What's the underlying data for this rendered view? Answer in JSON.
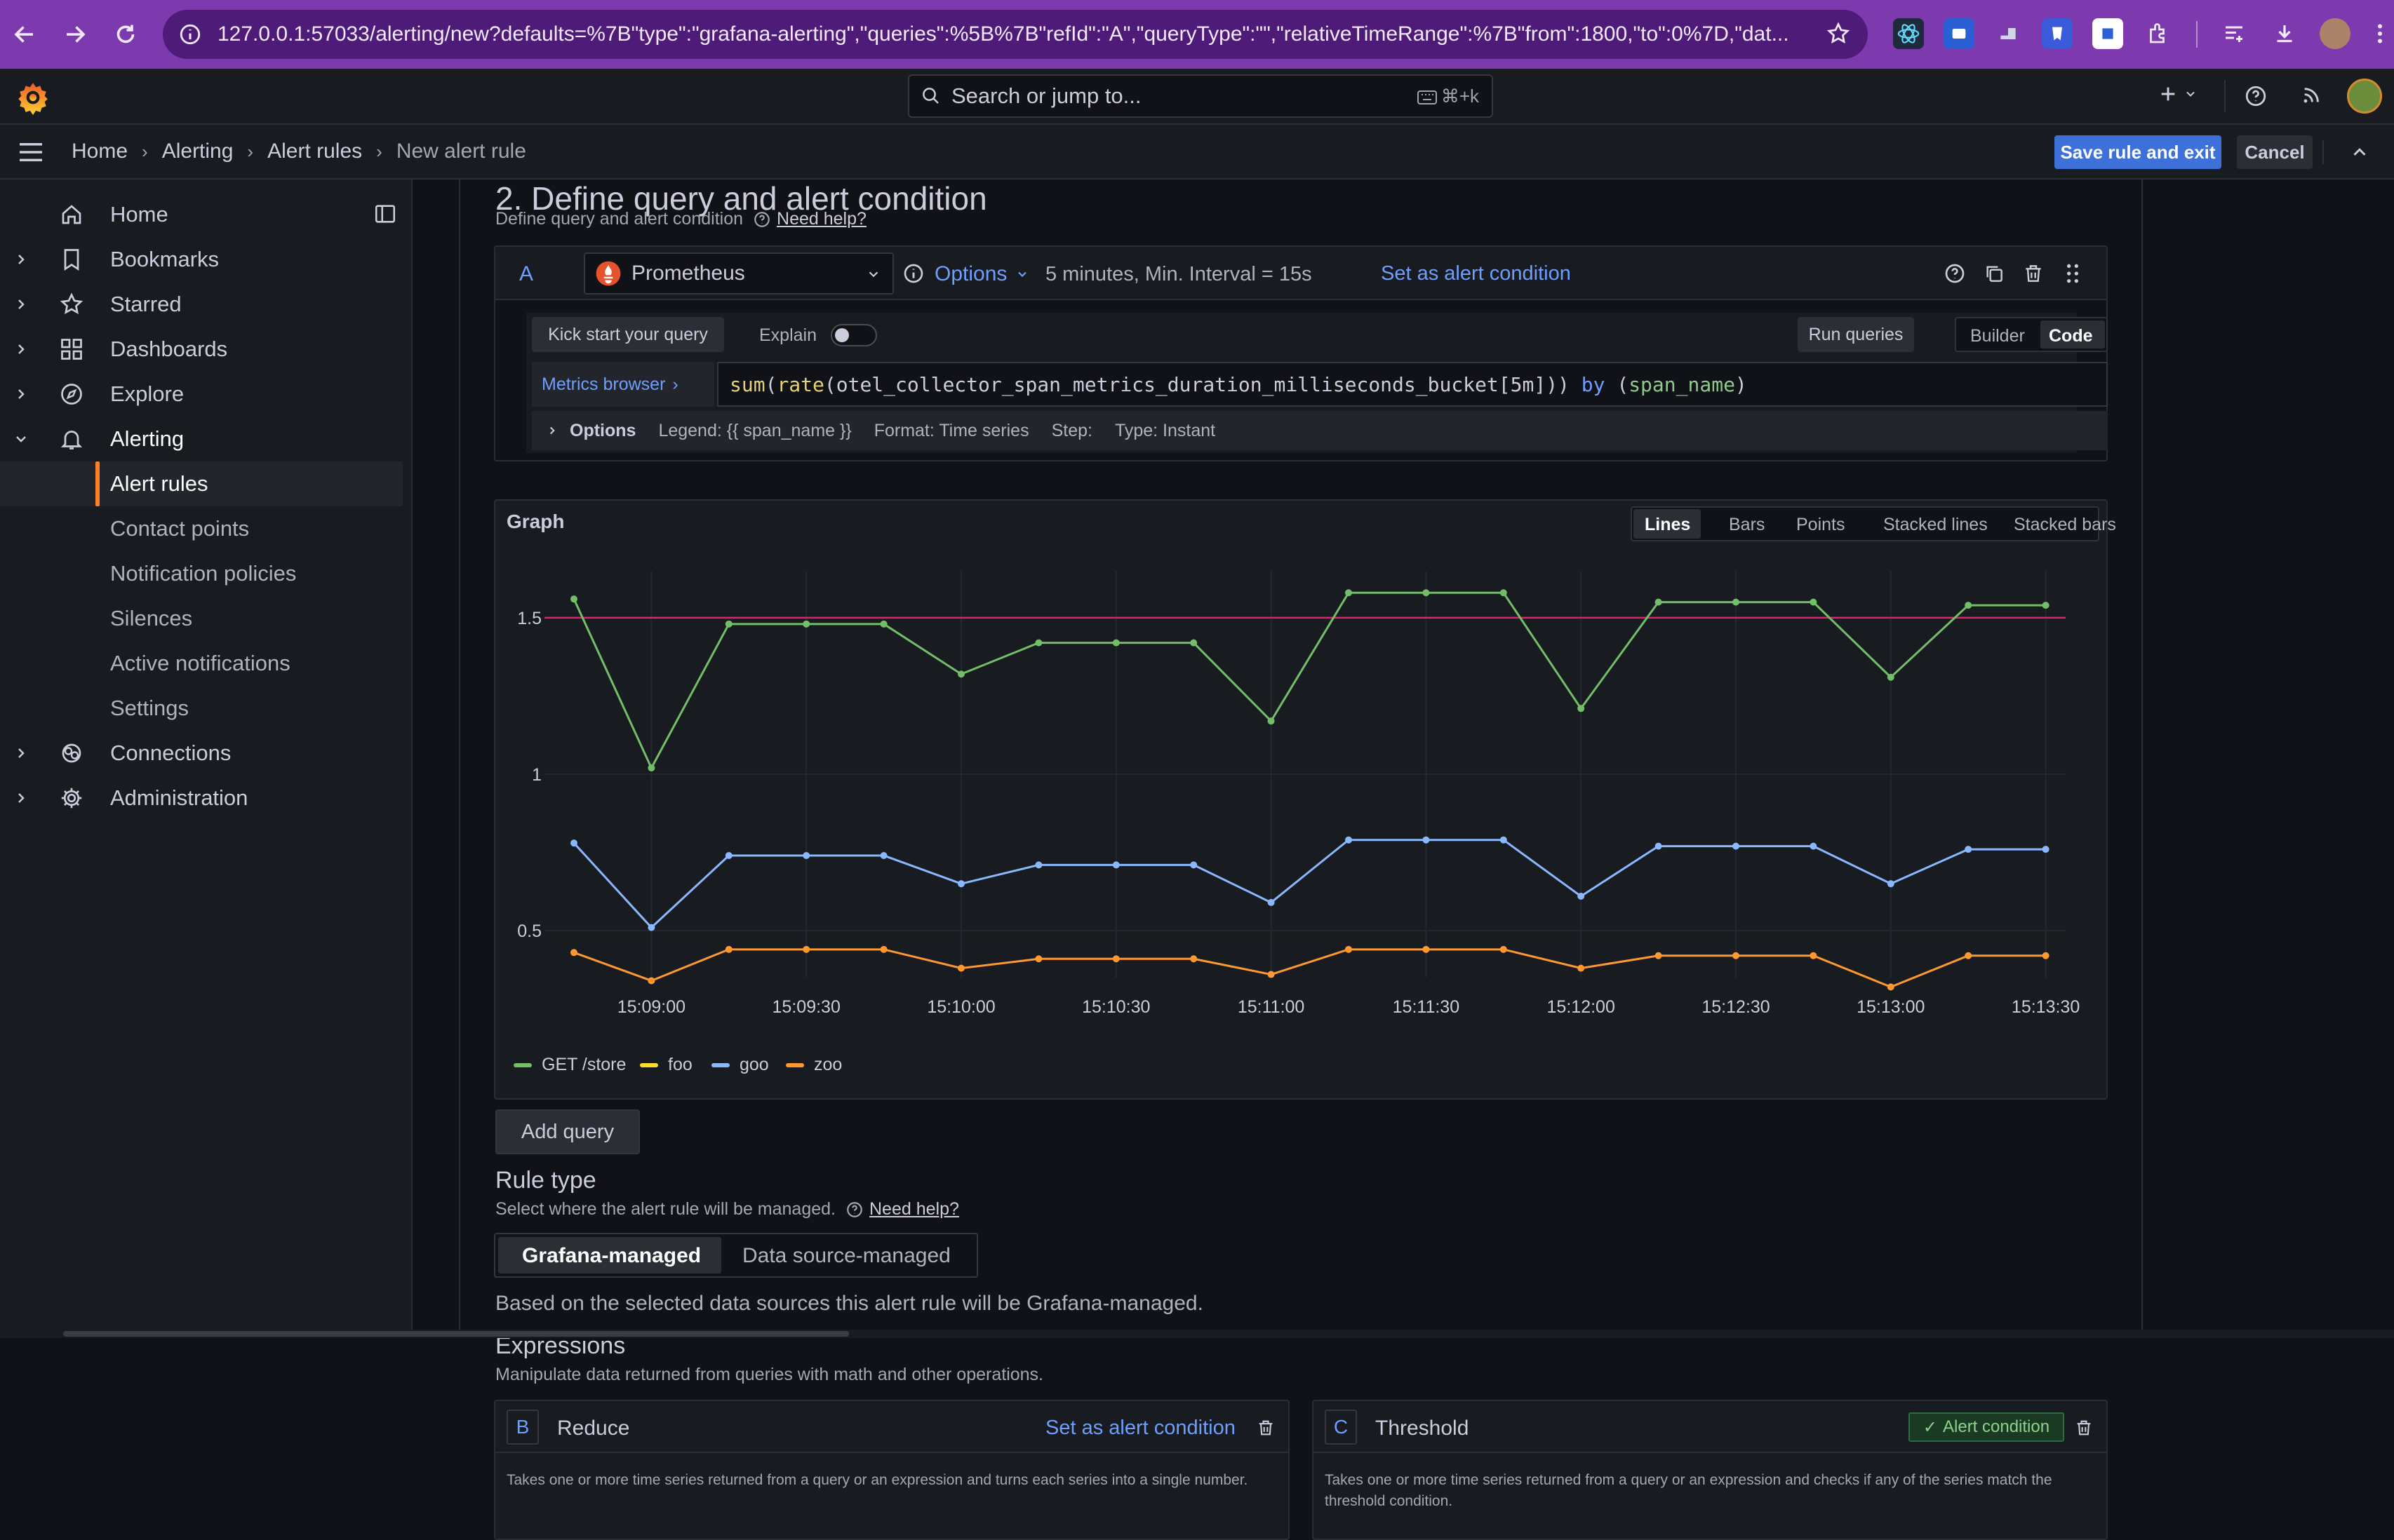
{
  "browser": {
    "url": "127.0.0.1:57033/alerting/new?defaults=%7B\"type\":\"grafana-alerting\",\"queries\":%5B%7B\"refId\":\"A\",\"queryType\":\"\",\"relativeTimeRange\":%7B\"from\":1800,\"to\":0%7D,\"dat..."
  },
  "topbar": {
    "search_placeholder": "Search or jump to...",
    "search_shortcut": "⌘+k"
  },
  "breadcrumb": {
    "items": [
      "Home",
      "Alerting",
      "Alert rules",
      "New alert rule"
    ]
  },
  "actions": {
    "save_label": "Save rule and exit",
    "cancel_label": "Cancel"
  },
  "sidebar": {
    "items": [
      {
        "label": "Home"
      },
      {
        "label": "Bookmarks"
      },
      {
        "label": "Starred"
      },
      {
        "label": "Dashboards"
      },
      {
        "label": "Explore"
      },
      {
        "label": "Alerting"
      },
      {
        "label": "Alert rules"
      },
      {
        "label": "Contact points"
      },
      {
        "label": "Notification policies"
      },
      {
        "label": "Silences"
      },
      {
        "label": "Active notifications"
      },
      {
        "label": "Settings"
      },
      {
        "label": "Connections"
      },
      {
        "label": "Administration"
      }
    ]
  },
  "section2": {
    "title": "2. Define query and alert condition",
    "desc": "Define query and alert condition",
    "help": "Need help?"
  },
  "query": {
    "ref_id": "A",
    "datasource": "Prometheus",
    "options_label": "Options",
    "interval_info": "5 minutes, Min. Interval = 15s",
    "set_condition": "Set as alert condition",
    "kick_start": "Kick start your query",
    "explain": "Explain",
    "run_queries": "Run queries",
    "mode_builder": "Builder",
    "mode_code": "Code",
    "metrics_browser": "Metrics browser",
    "expr_parts": [
      "sum",
      "(",
      "rate",
      "(",
      "otel_collector_span_metrics_duration_milliseconds_bucket[5m]",
      "))",
      " by ",
      "(",
      "span_name",
      ")"
    ],
    "opts_title": "Options",
    "opt_legend": "Legend: {{ span_name }}",
    "opt_format": "Format: Time series",
    "opt_step": "Step:",
    "opt_type": "Type: Instant"
  },
  "graph": {
    "title": "Graph",
    "view_tabs": [
      "Lines",
      "Bars",
      "Points",
      "Stacked lines",
      "Stacked bars"
    ]
  },
  "add_query": "Add query",
  "rule_type": {
    "title": "Rule type",
    "desc": "Select where the alert rule will be managed.",
    "help": "Need help?",
    "opt_grafana": "Grafana-managed",
    "opt_ds": "Data source-managed",
    "note": "Based on the selected data sources this alert rule will be Grafana-managed."
  },
  "expressions": {
    "title": "Expressions",
    "desc": "Manipulate data returned from queries with math and other operations.",
    "b": {
      "ref": "B",
      "name": "Reduce",
      "set_condition": "Set as alert condition",
      "desc": "Takes one or more time series returned from a query or an expression and turns each series into a single number."
    },
    "c": {
      "ref": "C",
      "name": "Threshold",
      "badge": "Alert condition",
      "desc": "Takes one or more time series returned from a query or an expression and checks if any of the series match the threshold condition."
    }
  },
  "colors": {
    "accent": "#6e9fff",
    "primary_button": "#3d71d9",
    "active_nav": "#ff7f2a",
    "series_green": "#73bf69",
    "series_yellow": "#fade2a",
    "series_blue": "#8ab8ff",
    "series_orange": "#ff9830",
    "threshold": "#e0226e"
  },
  "chart_data": {
    "type": "line",
    "title": "Graph",
    "x": [
      "15:08:45",
      "15:09:00",
      "15:09:15",
      "15:09:30",
      "15:09:45",
      "15:10:00",
      "15:10:15",
      "15:10:30",
      "15:10:45",
      "15:11:00",
      "15:11:15",
      "15:11:30",
      "15:11:45",
      "15:12:00",
      "15:12:15",
      "15:12:30",
      "15:12:45",
      "15:13:00",
      "15:13:15",
      "15:13:30"
    ],
    "x_ticks": [
      "15:09:00",
      "15:09:30",
      "15:10:00",
      "15:10:30",
      "15:11:00",
      "15:11:30",
      "15:12:00",
      "15:12:30",
      "15:13:00",
      "15:13:30"
    ],
    "y_ticks": [
      "0.5",
      "1",
      "1.5"
    ],
    "ylim": [
      0.35,
      1.65
    ],
    "threshold": 1.5,
    "legend_position": "bottom-left",
    "series": [
      {
        "name": "GET /store",
        "color": "#73bf69",
        "values": [
          1.56,
          1.02,
          1.48,
          1.48,
          1.48,
          1.32,
          1.42,
          1.42,
          1.42,
          1.17,
          1.58,
          1.58,
          1.58,
          1.21,
          1.55,
          1.55,
          1.55,
          1.31,
          1.54,
          1.54
        ]
      },
      {
        "name": "foo",
        "color": "#fade2a",
        "values": []
      },
      {
        "name": "goo",
        "color": "#8ab8ff",
        "values": [
          0.78,
          0.51,
          0.74,
          0.74,
          0.74,
          0.65,
          0.71,
          0.71,
          0.71,
          0.59,
          0.79,
          0.79,
          0.79,
          0.61,
          0.77,
          0.77,
          0.77,
          0.65,
          0.76,
          0.76
        ]
      },
      {
        "name": "zoo",
        "color": "#ff9830",
        "values": [
          0.43,
          0.34,
          0.44,
          0.44,
          0.44,
          0.38,
          0.41,
          0.41,
          0.41,
          0.36,
          0.44,
          0.44,
          0.44,
          0.38,
          0.42,
          0.42,
          0.42,
          0.32,
          0.42,
          0.42
        ]
      }
    ]
  }
}
